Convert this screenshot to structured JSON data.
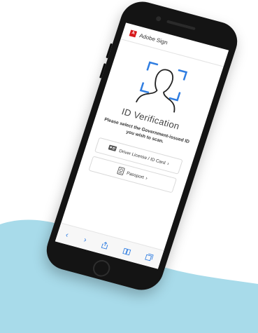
{
  "app": {
    "logo_text": "A",
    "title": "Adobe Sign"
  },
  "main": {
    "title": "ID Verification",
    "instruction": "Please select the Government-issued ID you wish to scan.",
    "options": [
      {
        "label": "Driver License / ID Card",
        "icon": "id-card-icon"
      },
      {
        "label": "Passport",
        "icon": "passport-icon"
      }
    ]
  },
  "browser_toolbar": {
    "icons": [
      "back-icon",
      "forward-icon",
      "share-icon",
      "bookmarks-icon",
      "tabs-icon"
    ]
  },
  "colors": {
    "accent": "#2f7de1",
    "brand": "#d7191c",
    "background_wave": "#a8dbea"
  }
}
